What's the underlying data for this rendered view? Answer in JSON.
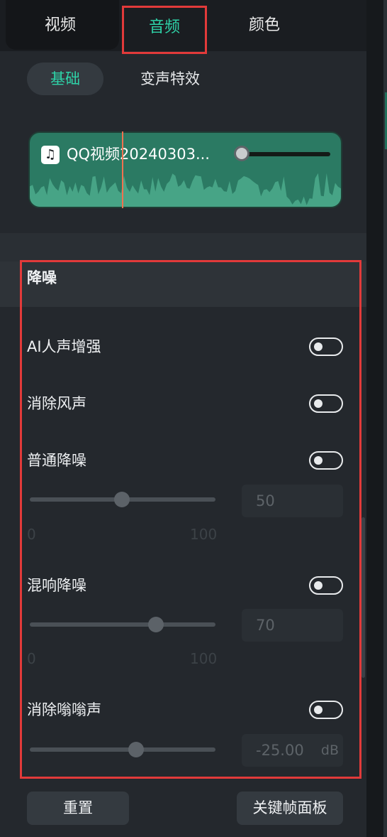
{
  "tabs": [
    {
      "label": "视频",
      "active": false
    },
    {
      "label": "音频",
      "active": true
    },
    {
      "label": "颜色",
      "active": false
    }
  ],
  "subtabs": [
    {
      "label": "基础",
      "active": true
    },
    {
      "label": "变声特效",
      "active": false
    }
  ],
  "clip": {
    "name": "QQ视频20240303...",
    "icon": "music-note-icon"
  },
  "noise_reduction": {
    "title": "降噪",
    "items": [
      {
        "label": "AI人声增强",
        "enabled": false
      },
      {
        "label": "消除风声",
        "enabled": false
      },
      {
        "label": "普通降噪",
        "enabled": false,
        "value": "50",
        "min": "0",
        "max": "100"
      },
      {
        "label": "混响降噪",
        "enabled": false,
        "value": "70",
        "min": "0",
        "max": "100"
      },
      {
        "label": "消除嗡嗡声",
        "enabled": false,
        "value": "-25.00",
        "unit": "dB"
      }
    ]
  },
  "footer": {
    "reset_label": "重置",
    "keyframe_label": "关键帧面板"
  },
  "colors": {
    "accent": "#2ed3a8",
    "clip_bg": "#2b7a63",
    "highlight": "#e23a3a"
  }
}
